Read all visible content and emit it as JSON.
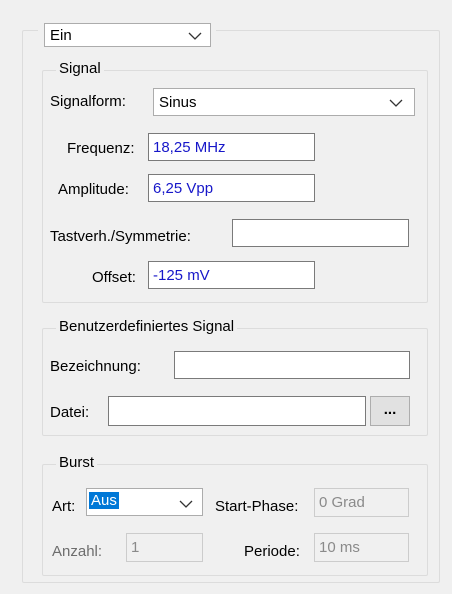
{
  "top_combo": {
    "value": "Ein"
  },
  "signal": {
    "title": "Signal",
    "waveform": {
      "label": "Signalform:",
      "value": "Sinus"
    },
    "frequency": {
      "label": "Frequenz:",
      "value": "18,25 MHz"
    },
    "amplitude": {
      "label": "Amplitude:",
      "value": "6,25 Vpp"
    },
    "duty": {
      "label": "Tastverh./Symmetrie:",
      "value": ""
    },
    "offset": {
      "label": "Offset:",
      "value": "-125 mV"
    }
  },
  "custom": {
    "title": "Benutzerdefiniertes Signal",
    "name": {
      "label": "Bezeichnung:",
      "value": ""
    },
    "file": {
      "label": "Datei:",
      "value": "",
      "browse_label": "..."
    }
  },
  "burst": {
    "title": "Burst",
    "mode": {
      "label": "Art:",
      "value": "Aus"
    },
    "start_phase": {
      "label": "Start-Phase:",
      "value": "0 Grad"
    },
    "count": {
      "label": "Anzahl:",
      "value": "1"
    },
    "period": {
      "label": "Periode:",
      "value": "10 ms"
    }
  },
  "colors": {
    "value_text": "#1717c9",
    "selection": "#0078d7",
    "group_border": "#dcdcdc"
  },
  "icons": {
    "dropdown": "chevron-down-icon"
  }
}
